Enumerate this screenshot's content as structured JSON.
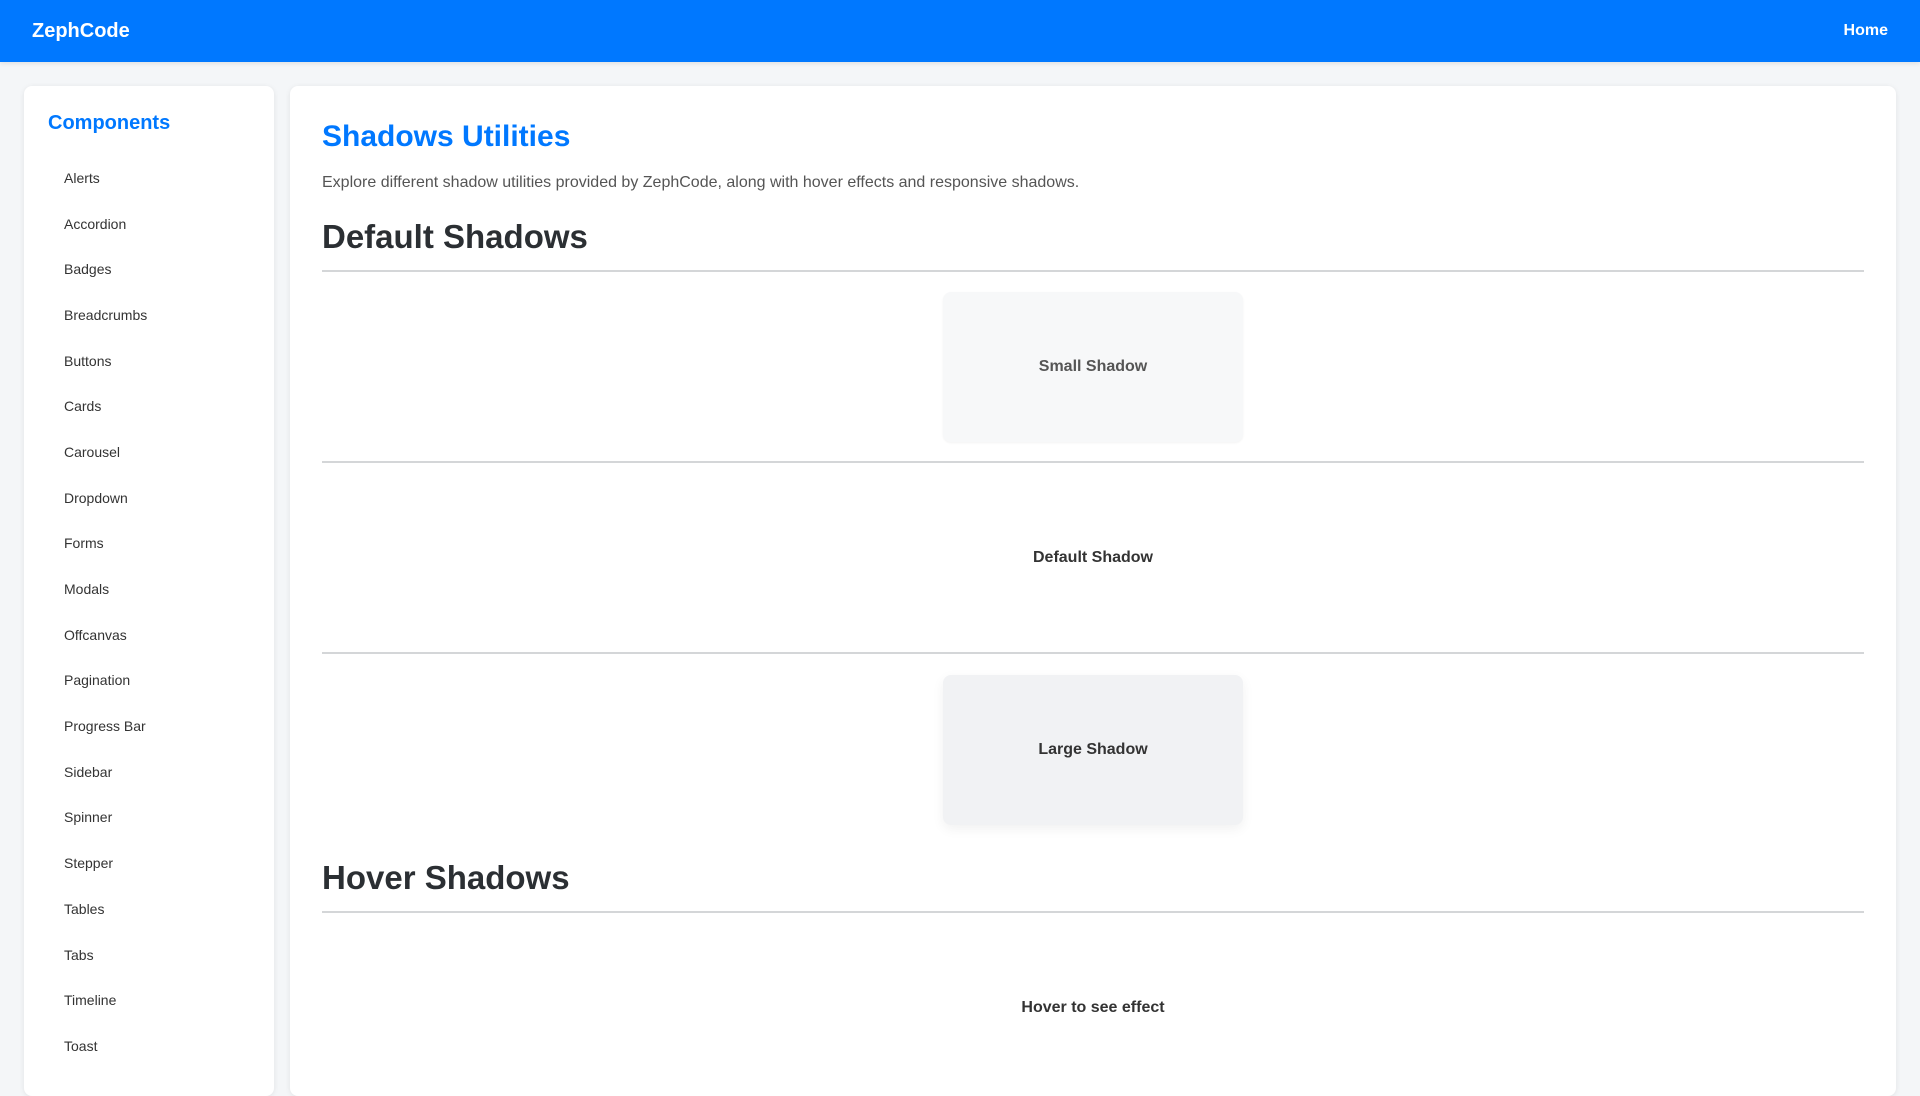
{
  "header": {
    "brand": "ZephCode",
    "nav_home": "Home"
  },
  "sidebar": {
    "title": "Components",
    "items": [
      {
        "label": "Alerts"
      },
      {
        "label": "Accordion"
      },
      {
        "label": "Badges"
      },
      {
        "label": "Breadcrumbs"
      },
      {
        "label": "Buttons"
      },
      {
        "label": "Cards"
      },
      {
        "label": "Carousel"
      },
      {
        "label": "Dropdown"
      },
      {
        "label": "Forms"
      },
      {
        "label": "Modals"
      },
      {
        "label": "Offcanvas"
      },
      {
        "label": "Pagination"
      },
      {
        "label": "Progress Bar"
      },
      {
        "label": "Sidebar"
      },
      {
        "label": "Spinner"
      },
      {
        "label": "Stepper"
      },
      {
        "label": "Tables"
      },
      {
        "label": "Tabs"
      },
      {
        "label": "Timeline"
      },
      {
        "label": "Toast"
      }
    ]
  },
  "main": {
    "title": "Shadows Utilities",
    "description": "Explore different shadow utilities provided by ZephCode, along with hover effects and responsive shadows.",
    "sections": {
      "default": {
        "heading": "Default Shadows",
        "boxes": {
          "small": "Small Shadow",
          "default": "Default Shadow",
          "large": "Large Shadow"
        }
      },
      "hover": {
        "heading": "Hover Shadows",
        "box": "Hover to see effect"
      }
    }
  },
  "colors": {
    "primary": "#0078ff",
    "heading": "#2b2f33",
    "divider": "#d4d6d8"
  }
}
